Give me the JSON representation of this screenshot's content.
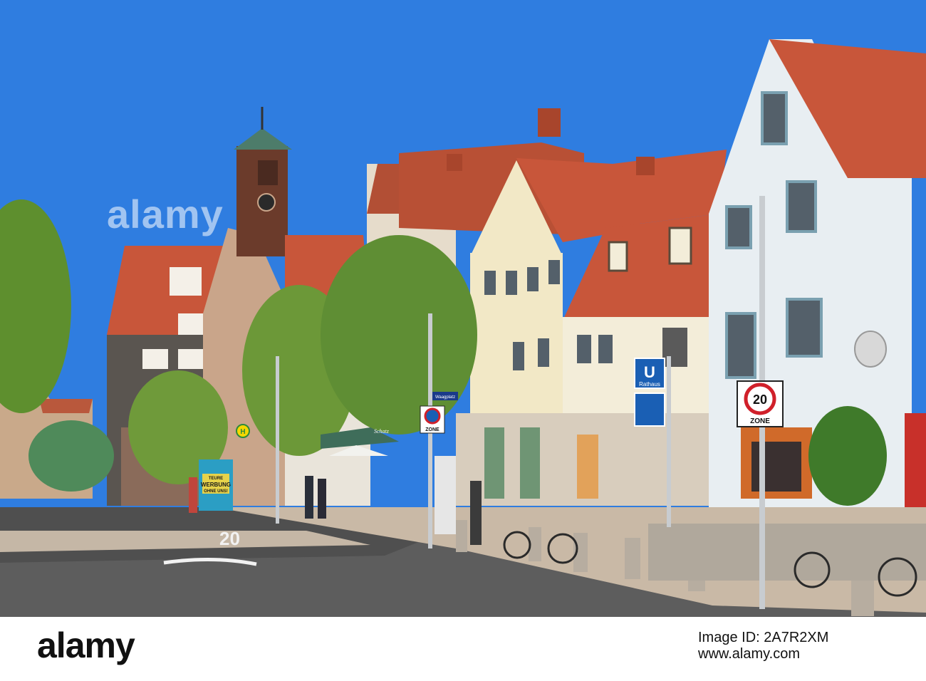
{
  "image": {
    "description_type": "street photograph",
    "colors": {
      "sky": "#2f7de0",
      "roof": "#c8563a",
      "road": "#5d5d5d",
      "sidewalk": "#c9b9a6",
      "foliage": "#5e8f2e"
    }
  },
  "signs": {
    "ubahn_letter": "U",
    "ubahn_station": "Rathaus",
    "speed_limit": "20",
    "speed_zone_label": "ZONE",
    "parking_zone_label": "ZONE",
    "street_name": "Waagplatz",
    "road_marking": "20",
    "shop_name": "Schatz",
    "ad_text_1": "TEURE",
    "ad_text_2": "WERBUNG",
    "ad_text_3": "OHNE UNS!",
    "bus_stop": "H"
  },
  "watermark": {
    "text": "alamy"
  },
  "footer": {
    "logo": "alamy",
    "image_id_label": "Image ID: 2A7R2XM",
    "www": "www.alamy.com",
    "code": "2A7R2XM"
  }
}
